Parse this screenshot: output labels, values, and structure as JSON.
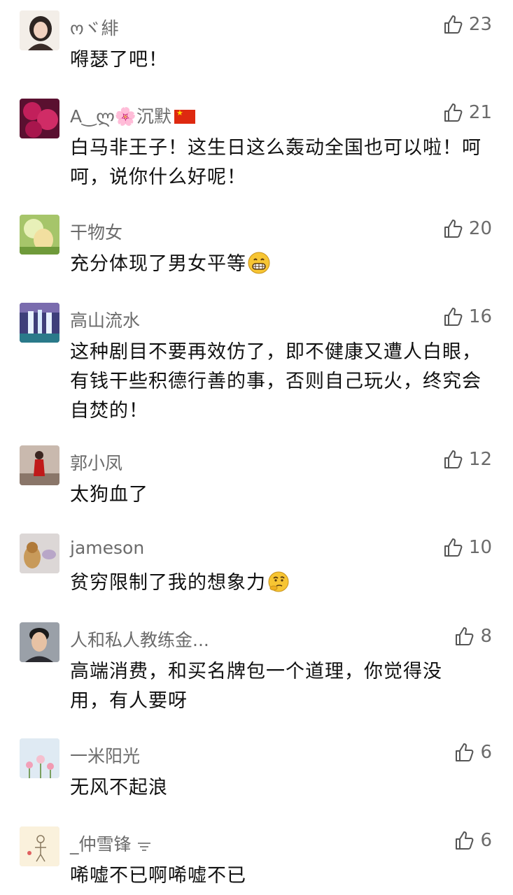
{
  "comments": [
    {
      "name": "ოヾ緋",
      "likes": "23",
      "text": "嘚瑟了吧！",
      "avatar": "woman-portrait-avatar"
    },
    {
      "name": "A‿ლ🌸沉默",
      "likes": "21",
      "text": "白马非王子！这生日这么轰动全国也可以啦！呵呵，说你什么好呢！",
      "avatar": "roses-avatar"
    },
    {
      "name": "干物女",
      "likes": "20",
      "text": "充分体现了男女平等",
      "avatar": "fairy-avatar"
    },
    {
      "name": "高山流水",
      "likes": "16",
      "text": "这种剧目不要再效仿了，即不健康又遭人白眼，有钱干些积德行善的事，否则自己玩火，终究会自焚的！",
      "avatar": "waterfall-avatar"
    },
    {
      "name": "郭小凤",
      "likes": "12",
      "text": "太狗血了",
      "avatar": "woman-red-dress-avatar"
    },
    {
      "name": "jameson",
      "likes": "10",
      "text": "贫穷限制了我的想象力",
      "avatar": "dog-avatar"
    },
    {
      "name": "人和私人教练金...",
      "likes": "8",
      "text": "高端消费，和买名牌包一个道理，你觉得没用，有人要呀",
      "avatar": "man-portrait-avatar"
    },
    {
      "name": "一米阳光",
      "likes": "6",
      "text": "无风不起浪",
      "avatar": "flowers-avatar"
    },
    {
      "name": "_仲雪锋",
      "likes": "6",
      "text": "唏嘘不已啊唏嘘不已",
      "avatar": "sketch-avatar"
    }
  ],
  "colors": {
    "name": "#6b6b6b",
    "text": "#111111",
    "icon": "#555555"
  }
}
